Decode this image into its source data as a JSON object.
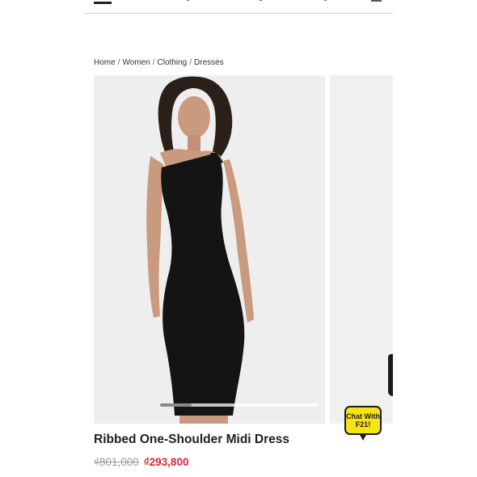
{
  "breadcrumb": [
    "Home",
    "Women",
    "Clothing",
    "Dresses"
  ],
  "breadcrumb_separator": "/",
  "gallery": {
    "slide_index": 1,
    "slide_count": 5
  },
  "chat": {
    "line1": "Chat With",
    "line2": "F21!"
  },
  "product": {
    "title": "Ribbed One-Shoulder Midi Dress",
    "original_price": "₫801,000",
    "sale_price": "₫293,800"
  },
  "colors": {
    "sale": "#d6263b",
    "chat_bg": "#f6e316",
    "dress": "#141414"
  }
}
